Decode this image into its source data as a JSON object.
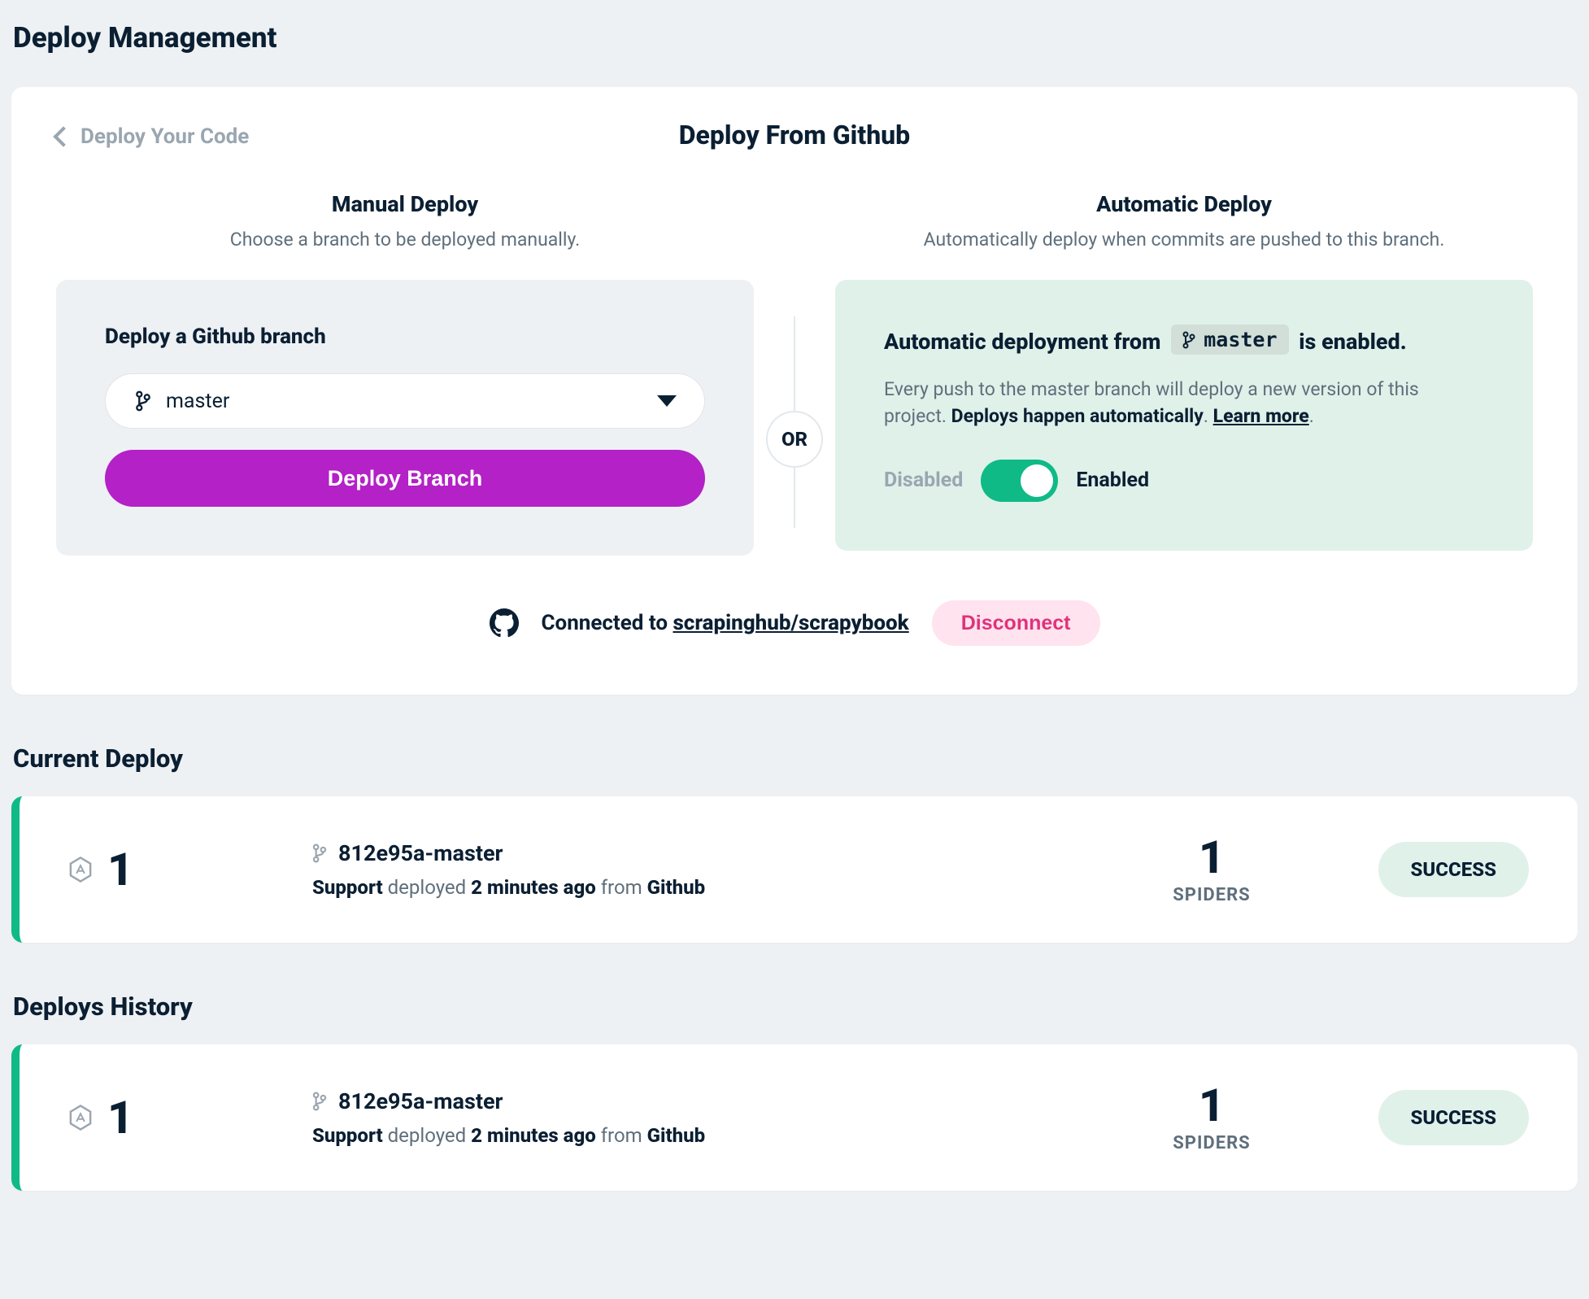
{
  "page": {
    "title": "Deploy Management"
  },
  "deployCard": {
    "backLabel": "Deploy Your Code",
    "title": "Deploy From Github",
    "manual": {
      "title": "Manual Deploy",
      "sub": "Choose a branch to be deployed manually.",
      "panelLabel": "Deploy a Github branch",
      "selectedBranch": "master",
      "button": "Deploy Branch"
    },
    "or": "OR",
    "auto": {
      "title": "Automatic Deploy",
      "sub": "Automatically deploy when commits are pushed to this branch.",
      "headingPrefix": "Automatic deployment from",
      "branch": "master",
      "headingSuffix": "is enabled.",
      "desc1": "Every push to the master branch will deploy a new version of this project. ",
      "desc2": "Deploys happen automatically",
      "desc3": ". ",
      "learnMore": "Learn more",
      "disabled": "Disabled",
      "enabled": "Enabled"
    },
    "connected": {
      "prefix": "Connected to ",
      "repo": "scrapinghub/scrapybook",
      "disconnect": "Disconnect"
    }
  },
  "currentDeploy": {
    "title": "Current Deploy",
    "id": "1",
    "commit": "812e95a-master",
    "user": "Support",
    "action": " deployed ",
    "time": "2 minutes ago",
    "from": " from ",
    "source": "Github",
    "spidersCount": "1",
    "spidersLabel": "SPIDERS",
    "status": "SUCCESS"
  },
  "history": {
    "title": "Deploys History",
    "rows": [
      {
        "id": "1",
        "commit": "812e95a-master",
        "user": "Support",
        "action": " deployed ",
        "time": "2 minutes ago",
        "from": " from ",
        "source": "Github",
        "spidersCount": "1",
        "spidersLabel": "SPIDERS",
        "status": "SUCCESS"
      }
    ]
  }
}
